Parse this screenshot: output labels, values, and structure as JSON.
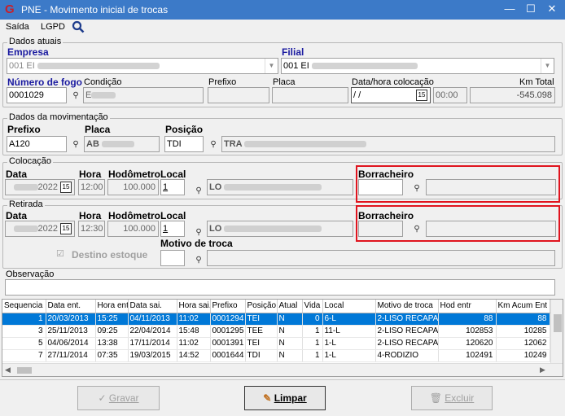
{
  "window": {
    "title": "PNE - Movimento inicial de trocas",
    "logo": "G",
    "minimize": "—",
    "maximize": "☐",
    "close": "✕"
  },
  "menu": {
    "items": [
      "Saída",
      "LGPD"
    ],
    "search_icon": "search-icon"
  },
  "dados_atuais": {
    "legend": "Dados atuais",
    "empresa_label": "Empresa",
    "empresa_value": "001 EI",
    "filial_label": "Filial",
    "filial_value": "001 EI",
    "numero_fogo_label": "Número de fogo",
    "numero_fogo_value": "0001029",
    "condicao_label": "Condição",
    "condicao_value": "E",
    "prefixo_label": "Prefixo",
    "placa_label": "Placa",
    "data_hora_label": "Data/hora colocação",
    "data_value": " /  /",
    "hora_value": "00:00",
    "km_total_label": "Km Total",
    "km_total_value": "-545.098"
  },
  "dados_movimentacao": {
    "legend": "Dados da movimentação",
    "prefixo_label": "Prefixo",
    "prefixo_value": "A120",
    "placa_label": "Placa",
    "placa_value": "AB",
    "posicao_label": "Posição",
    "posicao_value": "TDI",
    "posicao_desc": "TRA"
  },
  "colocacao": {
    "legend": "Colocação",
    "data_label": "Data",
    "data_value": "2022",
    "hora_label": "Hora",
    "hora_value": "12:00",
    "hodometro_label": "Hodômetro",
    "hodometro_value": "100.000",
    "local_label": "Local",
    "local_value": "1",
    "local_desc": "LO",
    "borracheiro_label": "Borracheiro",
    "borracheiro_value": ""
  },
  "retirada": {
    "legend": "Retirada",
    "data_label": "Data",
    "data_value": "2022",
    "hora_label": "Hora",
    "hora_value": "12:30",
    "hodometro_label": "Hodômetro",
    "hodometro_value": "100.000",
    "local_label": "Local",
    "local_value": "1",
    "local_desc": "LO",
    "borracheiro_label": "Borracheiro",
    "borracheiro_value": "",
    "destino_label": "Destino estoque",
    "destino_check": "☑",
    "motivo_label": "Motivo de troca",
    "motivo_value": ""
  },
  "observacao": {
    "label": "Observação",
    "value": ""
  },
  "table": {
    "headers": [
      "Sequencia",
      "Data ent.",
      "Hora ent",
      "Data sai.",
      "Hora sai.",
      "Prefixo",
      "Posição",
      "Atual",
      "Vida",
      "Local",
      "Motivo de troca",
      "Hod entr",
      "Km Acum Ent"
    ],
    "rows": [
      [
        "1",
        "20/03/2013",
        "15:25",
        "04/11/2013",
        "11:02",
        "0001294",
        "TEI",
        "N",
        "0",
        "6-L",
        "2-LISO RECAPA",
        "88",
        "88"
      ],
      [
        "3",
        "25/11/2013",
        "09:25",
        "22/04/2014",
        "15:48",
        "0001295",
        "TEE",
        "N",
        "1",
        "11-L",
        "2-LISO RECAPA",
        "102853",
        "10285"
      ],
      [
        "5",
        "04/06/2014",
        "13:38",
        "17/11/2014",
        "11:02",
        "0001391",
        "TEI",
        "N",
        "1",
        "1-L",
        "2-LISO RECAPA",
        "120620",
        "12062"
      ],
      [
        "7",
        "27/11/2014",
        "07:35",
        "19/03/2015",
        "14:52",
        "0001644",
        "TDI",
        "N",
        "1",
        "1-L",
        "4-RODIZIO",
        "102491",
        "10249"
      ]
    ]
  },
  "buttons": {
    "gravar": "Gravar",
    "limpar": "Limpar",
    "excluir": "Excluir"
  },
  "colors": {
    "titlebar": "#3c7ac8",
    "selection": "#0078d7",
    "highlight": "#e0141e",
    "label_blue": "#1a1aa0"
  }
}
